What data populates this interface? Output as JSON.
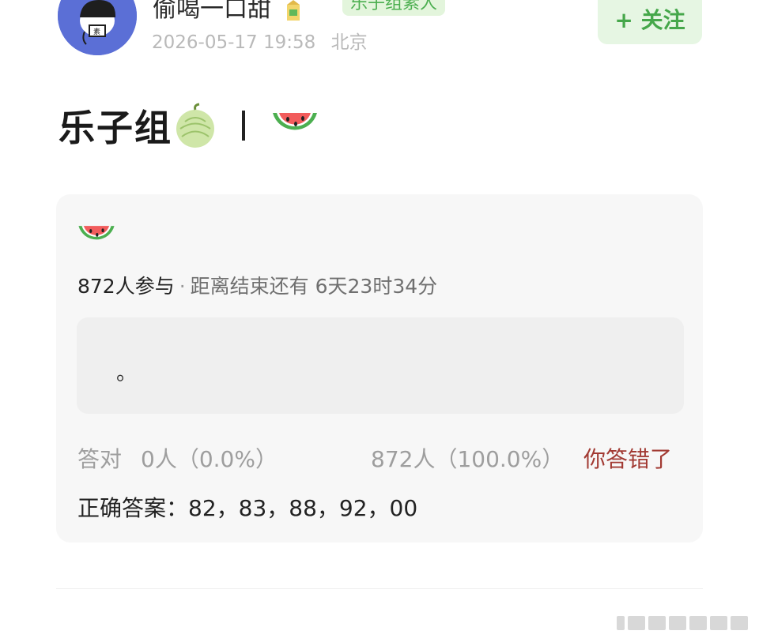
{
  "header": {
    "username": "偷喝一口甜",
    "tag": "乐子组素人",
    "date": "2026-05-17 19:58",
    "location": "北京",
    "follow_label": "+ 关注"
  },
  "post": {
    "title": "乐子组",
    "title_icons": [
      "melon-icon",
      "watermelon-icon"
    ]
  },
  "quiz": {
    "icon": "watermelon-icon",
    "participants": "872人参与",
    "separator": "·",
    "remaining": "距离结束还有 6天23时34分",
    "answer_text": "。",
    "correct_label": "答对",
    "correct_stats": "0人（0.0%）",
    "wrong_stats": "872人（100.0%）",
    "wrong_label": "你答错了",
    "correct_answer": "正确答案：82，83，88，92，00"
  },
  "colors": {
    "follow_green": "#45a74a",
    "tag_bg": "#e3f5dc",
    "wrong_red": "#a23a33",
    "avatar_blue": "#5b6fd6"
  }
}
